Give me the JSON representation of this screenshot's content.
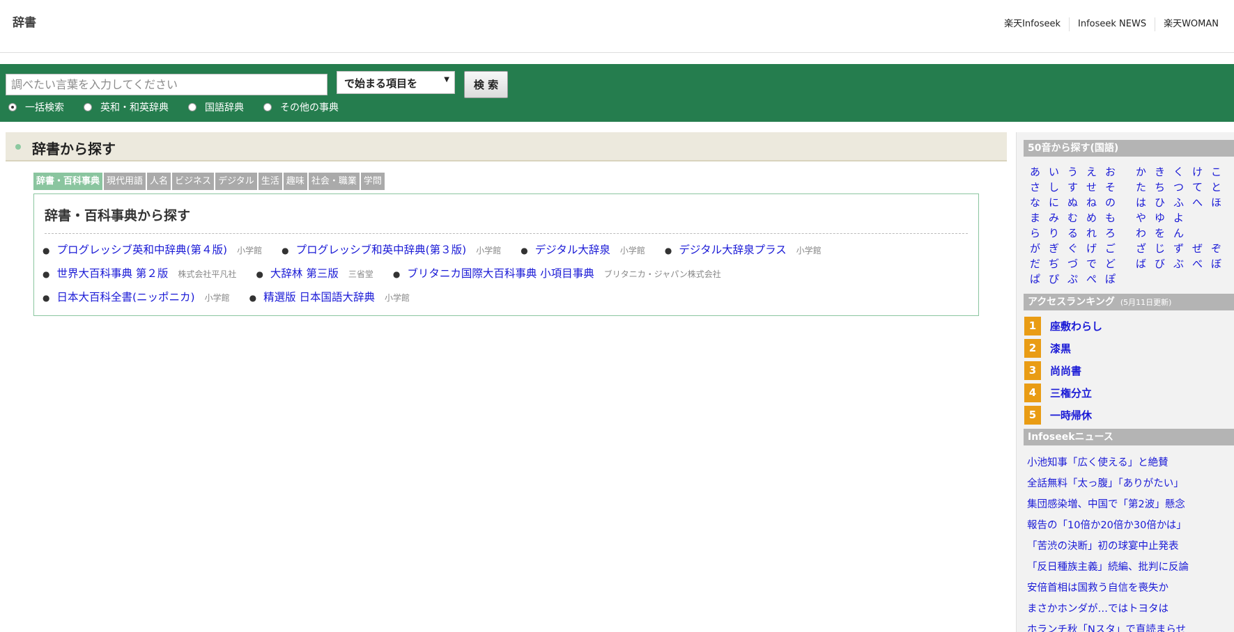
{
  "header": {
    "logo": "辞書",
    "links": [
      "楽天Infoseek",
      "Infoseek NEWS",
      "楽天WOMAN"
    ]
  },
  "search": {
    "placeholder": "調べたい言葉を入力してください",
    "mode_selected": "で始まる項目を",
    "button_label": "検 索",
    "radio_options": [
      {
        "label": "一括検索",
        "checked": true
      },
      {
        "label": "英和・和英辞典",
        "checked": false
      },
      {
        "label": "国語辞典",
        "checked": false
      },
      {
        "label": "その他の事典",
        "checked": false
      }
    ]
  },
  "main": {
    "section_title": "辞書から探す",
    "tabs": [
      "辞書・百科事典",
      "現代用語",
      "人名",
      "ビジネス",
      "デジタル",
      "生活",
      "趣味",
      "社会・職業",
      "学問"
    ],
    "active_tab": 0,
    "box_title": "辞書・百科事典から探す",
    "dictionary_rows": [
      [
        {
          "name": "プログレッシブ英和中辞典(第４版)",
          "publisher": "小学館"
        },
        {
          "name": "プログレッシブ和英中辞典(第３版)",
          "publisher": "小学館"
        },
        {
          "name": "デジタル大辞泉",
          "publisher": "小学館"
        },
        {
          "name": "デジタル大辞泉プラス",
          "publisher": "小学館"
        }
      ],
      [
        {
          "name": "世界大百科事典 第２版",
          "publisher": "株式会社平凡社"
        },
        {
          "name": "大辞林 第三版",
          "publisher": "三省堂"
        },
        {
          "name": "ブリタニカ国際大百科事典 小項目事典",
          "publisher": "ブリタニカ・ジャパン株式会社"
        }
      ],
      [
        {
          "name": "日本大百科全書(ニッポニカ)",
          "publisher": "小学館"
        },
        {
          "name": "精選版 日本国語大辞典",
          "publisher": "小学館"
        }
      ]
    ]
  },
  "sidebar": {
    "kana_title": "50音から探す(国語)",
    "kana_rows": [
      [
        [
          "あ",
          "い",
          "う",
          "え",
          "お"
        ],
        [
          "か",
          "き",
          "く",
          "け",
          "こ"
        ]
      ],
      [
        [
          "さ",
          "し",
          "す",
          "せ",
          "そ"
        ],
        [
          "た",
          "ち",
          "つ",
          "て",
          "と"
        ]
      ],
      [
        [
          "な",
          "に",
          "ぬ",
          "ね",
          "の"
        ],
        [
          "は",
          "ひ",
          "ふ",
          "へ",
          "ほ"
        ]
      ],
      [
        [
          "ま",
          "み",
          "む",
          "め",
          "も"
        ],
        [
          "や",
          "ゆ",
          "よ"
        ]
      ],
      [
        [
          "ら",
          "り",
          "る",
          "れ",
          "ろ"
        ],
        [
          "わ",
          "を",
          "ん"
        ]
      ],
      [
        [
          "が",
          "ぎ",
          "ぐ",
          "げ",
          "ご"
        ],
        [
          "ざ",
          "じ",
          "ず",
          "ぜ",
          "ぞ"
        ]
      ],
      [
        [
          "だ",
          "ぢ",
          "づ",
          "で",
          "ど"
        ],
        [
          "ば",
          "び",
          "ぶ",
          "べ",
          "ぼ"
        ]
      ],
      [
        [
          "ぱ",
          "ぴ",
          "ぷ",
          "ぺ",
          "ぽ"
        ],
        []
      ]
    ],
    "ranking_title": "アクセスランキング",
    "ranking_date": "(5月11日更新)",
    "ranking": [
      {
        "rank": "1",
        "word": "座敷わらし"
      },
      {
        "rank": "2",
        "word": "漆黒"
      },
      {
        "rank": "3",
        "word": "尚尚書"
      },
      {
        "rank": "4",
        "word": "三権分立"
      },
      {
        "rank": "5",
        "word": "一時帰休"
      }
    ],
    "news_title": "Infoseekニュース",
    "news": [
      "小池知事「広く使える」と絶賛",
      "全話無料「太っ腹」「ありがたい」",
      "集団感染増、中国で「第2波」懸念",
      "報告の「10倍か20倍か30倍かは」",
      "「苦渋の決断」初の球宴中止発表",
      "「反日種族主義」続編、批判に反論",
      "安倍首相は国救う自信を喪失か",
      "まさかホンダが…ではトヨタは",
      "ホランチ秋「Nスタ」で直読まらせ"
    ]
  }
}
